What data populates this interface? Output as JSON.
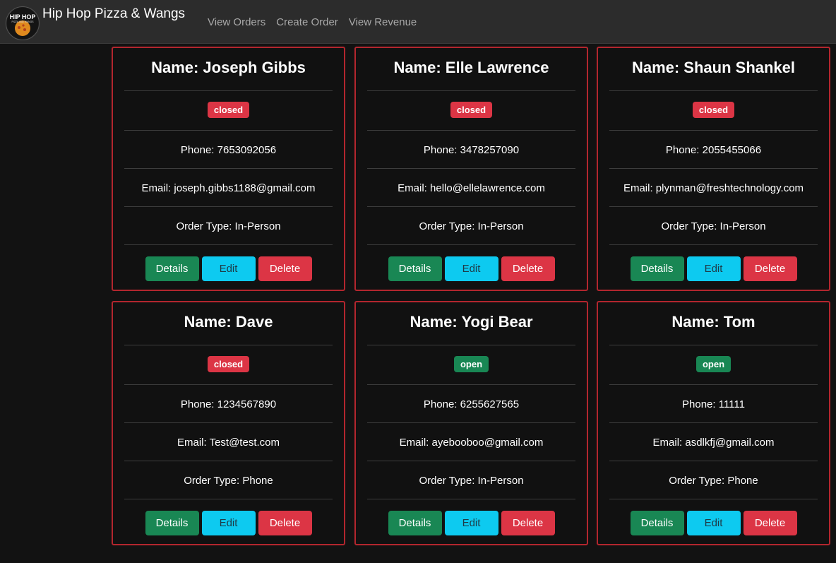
{
  "navbar": {
    "brand": "Hip Hop Pizza & Wangs",
    "logo_text_top": "HIP HOP",
    "logo_text_bottom": "PIZZA AND WANGS",
    "links": [
      "View Orders",
      "Create Order",
      "View Revenue"
    ]
  },
  "status_colors": {
    "closed": "#dc3545",
    "open": "#198754"
  },
  "buttons": {
    "details": "Details",
    "edit": "Edit",
    "delete": "Delete"
  },
  "orders": [
    {
      "name": "Name: Joseph Gibbs",
      "status": "closed",
      "phone": "Phone: 7653092056",
      "email": "Email: joseph.gibbs1188@gmail.com",
      "order_type": "Order Type: In-Person"
    },
    {
      "name": "Name: Elle Lawrence",
      "status": "closed",
      "phone": "Phone: 3478257090",
      "email": "Email: hello@ellelawrence.com",
      "order_type": "Order Type: In-Person"
    },
    {
      "name": "Name: Shaun Shankel",
      "status": "closed",
      "phone": "Phone: 2055455066",
      "email": "Email: plynman@freshtechnology.com",
      "order_type": "Order Type: In-Person"
    },
    {
      "name": "Name: Dave",
      "status": "closed",
      "phone": "Phone: 1234567890",
      "email": "Email: Test@test.com",
      "order_type": "Order Type: Phone"
    },
    {
      "name": "Name: Yogi Bear",
      "status": "open",
      "phone": "Phone: 6255627565",
      "email": "Email: ayebooboo@gmail.com",
      "order_type": "Order Type: In-Person"
    },
    {
      "name": "Name: Tom",
      "status": "open",
      "phone": "Phone: 11111",
      "email": "Email: asdlkfj@gmail.com",
      "order_type": "Order Type: Phone"
    }
  ]
}
